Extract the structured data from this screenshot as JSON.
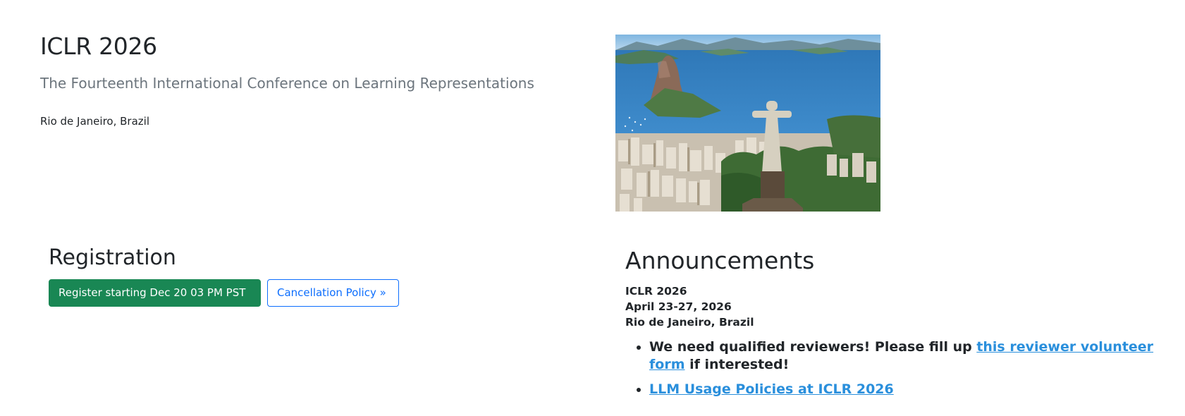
{
  "header": {
    "title": "ICLR 2026",
    "subtitle": "The Fourteenth International Conference on Learning Representations",
    "location": "Rio de Janeiro, Brazil"
  },
  "hero_image": {
    "icon": "rio-christ-the-redeemer-photo"
  },
  "registration": {
    "heading": "Registration",
    "register_button": "Register starting Dec 20 03 PM PST",
    "cancellation_button": "Cancellation Policy »"
  },
  "announcements": {
    "heading": "Announcements",
    "info_lines": [
      "ICLR 2026",
      "April 23-27, 2026",
      "Rio de Janeiro, Brazil"
    ],
    "items": [
      {
        "prefix": "We need qualified reviewers! Please fill up ",
        "link": "this reviewer volunteer form",
        "suffix": " if interested!"
      },
      {
        "prefix": "",
        "link": "LLM Usage Policies at ICLR 2026",
        "suffix": ""
      }
    ]
  },
  "colors": {
    "register_green": "#198754",
    "outline_blue": "#0d6efd",
    "link_blue": "#2a8fdc",
    "subtitle_gray": "#6c757d"
  }
}
